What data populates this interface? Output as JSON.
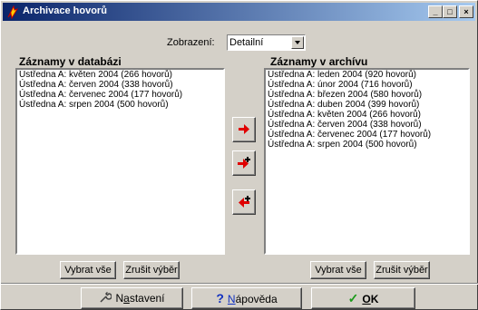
{
  "window": {
    "title": "Archivace hovorů",
    "minimize": "_",
    "maximize": "□",
    "close": "×"
  },
  "view": {
    "label": "Zobrazení:",
    "selected": "Detailní"
  },
  "database": {
    "heading": "Záznamy v databázi",
    "items": [
      "Ústředna A: květen 2004 (266 hovorů)",
      "Ústředna A: červen 2004 (338 hovorů)",
      "Ústředna A: červenec 2004 (177 hovorů)",
      "Ústředna A: srpen 2004 (500 hovorů)"
    ],
    "select_all": "Vybrat vše",
    "clear": "Zrušit výběr"
  },
  "archive": {
    "heading": "Záznamy v archívu",
    "items": [
      "Ústředna A: leden 2004 (920 hovorů)",
      "Ústředna A: únor 2004 (716 hovorů)",
      "Ústředna A: březen 2004 (580 hovorů)",
      "Ústředna A: duben 2004 (399 hovorů)",
      "Ústředna A: květen 2004 (266 hovorů)",
      "Ústředna A: červen 2004 (338 hovorů)",
      "Ústředna A: červenec 2004 (177 hovorů)",
      "Ústředna A: srpen 2004 (500 hovorů)"
    ],
    "select_all": "Vybrat vše",
    "clear": "Zrušit výběr"
  },
  "footer": {
    "settings_pre": "N",
    "settings_u": "a",
    "settings_post": "stavení",
    "help_u": "N",
    "help_post": "ápověda",
    "ok_u": "O",
    "ok_post": "K"
  },
  "colors": {
    "arrow_red": "#e00000",
    "ok_green": "#1a9a1a",
    "help_blue": "#1030c0",
    "title_start": "#0a246a",
    "title_end": "#a6caf0"
  }
}
